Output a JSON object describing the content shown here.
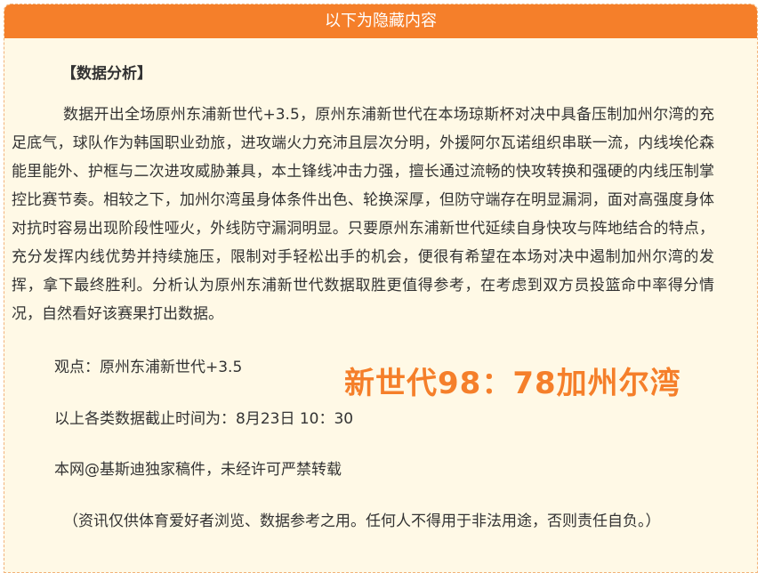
{
  "header": {
    "title": "以下为隐藏内容"
  },
  "section": {
    "title": "【数据分析】"
  },
  "analysis": {
    "paragraph": "数据开出全场原州东浦新世代+3.5，原州东浦新世代在本场琼斯杯对决中具备压制加州尔湾的充足底气，球队作为韩国职业劲旅，进攻端火力充沛且层次分明，外援阿尔瓦诺组织串联一流，内线埃伦森能里能外、护框与二次进攻威胁兼具，本土锋线冲击力强，擅长通过流畅的快攻转换和强硬的内线压制掌控比赛节奏。相较之下，加州尔湾虽身体条件出色、轮换深厚，但防守端存在明显漏洞，面对高强度身体对抗时容易出现阶段性哑火，外线防守漏洞明显。只要原州东浦新世代延续自身快攻与阵地结合的特点，充分发挥内线优势并持续施压，限制对手轻松出手的机会，便很有希望在本场对决中遏制加州尔湾的发挥，拿下最终胜利。分析认为原州东浦新世代数据取胜更值得参考，在考虑到双方员投篮命中率得分情况，自然看好该赛果打出数据。"
  },
  "view": "观点：原州东浦新世代+3.5",
  "score": "新世代98：78加州尔湾",
  "deadline": "以上各类数据截止时间为：8月23日 10：30",
  "copyright": "本网@基斯迪独家稿件，未经许可严禁转载",
  "disclaimer": "（资讯仅供体育爱好者浏览、数据参考之用。任何人不得用于非法用途，否则责任自负。）",
  "colors": {
    "accent": "#f57f2a",
    "panel_bg": "#fff9e6",
    "text": "#333333"
  }
}
